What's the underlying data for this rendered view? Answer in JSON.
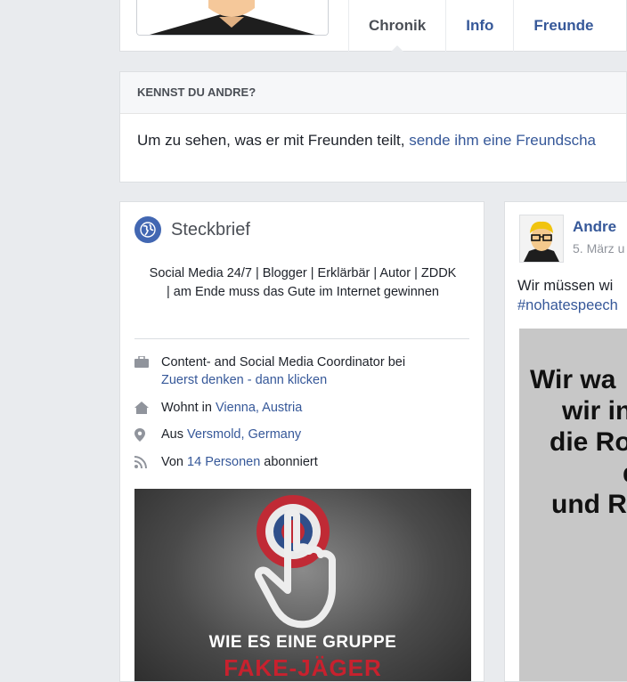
{
  "header": {
    "tabs": [
      {
        "label": "Chronik"
      },
      {
        "label": "Info"
      },
      {
        "label": "Freunde"
      }
    ]
  },
  "know_card": {
    "title": "KENNST DU ANDRE?",
    "text": "Um zu sehen, was er mit Freunden teilt,",
    "link": "sende ihm eine Freundscha"
  },
  "intro": {
    "title": "Steckbrief",
    "bio": "Social Media 24/7 | Blogger | Erklärbär | Autor | ZDDK | am Ende muss das Gute im Internet gewinnen",
    "work": {
      "text": "Content- and Social Media Coordinator bei",
      "link": "Zuerst denken - dann klicken"
    },
    "lives": {
      "prefix": "Wohnt in",
      "link": "Vienna, Austria"
    },
    "from": {
      "prefix": "Aus",
      "link": "Versmold, Germany"
    },
    "followers": {
      "prefix": "Von",
      "link": "14 Personen",
      "suffix": "abonniert"
    },
    "promo": {
      "line1": "WIE ES EINE GRUPPE",
      "line2": "FAKE-JÄGER"
    }
  },
  "post": {
    "author": "Andre",
    "date": "5. März u",
    "text_line1": "Wir müssen wi",
    "hashtag": "#nohatespeech",
    "image_lines": [
      "Wir wa",
      "wir in",
      "die Ro",
      "d",
      "und R"
    ]
  },
  "colors": {
    "link": "#365899",
    "accent": "#4267b2",
    "promo_red": "#c8212e"
  }
}
